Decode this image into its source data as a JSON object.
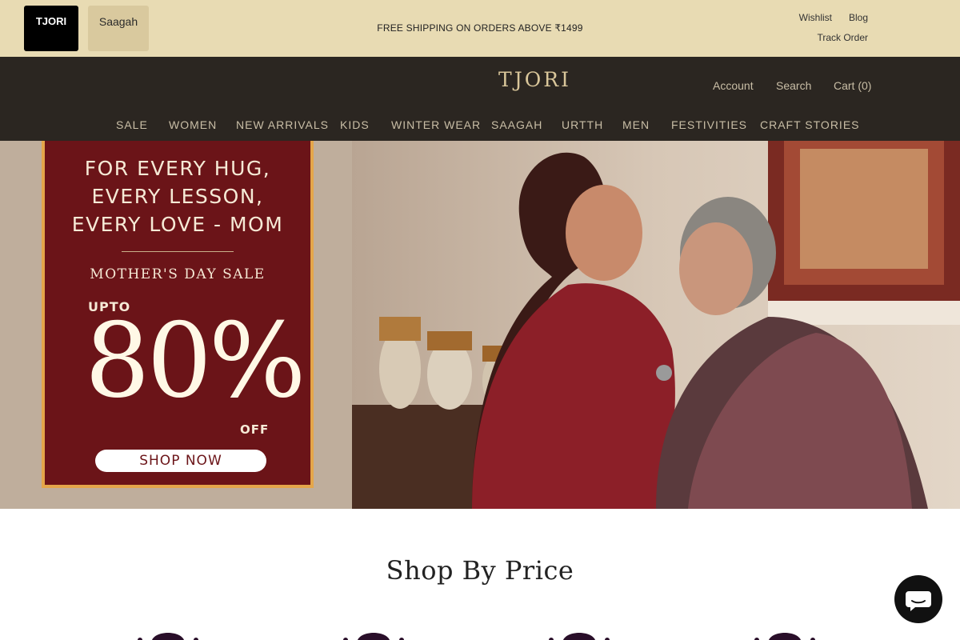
{
  "topbar": {
    "store_tabs": [
      {
        "label": "TJORI"
      },
      {
        "label": "Saagah"
      }
    ],
    "announcement": "FREE SHIPPING ON ORDERS ABOVE ₹1499",
    "links": {
      "wishlist": "Wishlist",
      "blog": "Blog",
      "track_order": "Track Order"
    }
  },
  "header": {
    "logo": "TJORI",
    "links": {
      "account": "Account",
      "search": "Search",
      "cart": "Cart (0)"
    },
    "nav": [
      "SALE",
      "WOMEN",
      "NEW ARRIVALS",
      "KIDS",
      "WINTER WEAR",
      "SAAGAH",
      "URTTH",
      "MEN",
      "FESTIVITIES",
      "CRAFT STORIES"
    ]
  },
  "hero": {
    "headline_lines": [
      "FOR EVERY HUG,",
      "EVERY LESSON,",
      "EVERY LOVE - MOM"
    ],
    "sale_name": "MOTHER'S DAY SALE",
    "upto": "UPTO",
    "discount": "80%",
    "off": "OFF",
    "cta": "SHOP NOW"
  },
  "shop_by_price": {
    "title": "Shop By Price"
  },
  "colors": {
    "topbar_bg": "#e8dbb3",
    "header_bg": "#2b2621",
    "promo_bg": "#6b1418",
    "promo_border": "#e4a64a",
    "nav_text": "#c9bea6"
  }
}
